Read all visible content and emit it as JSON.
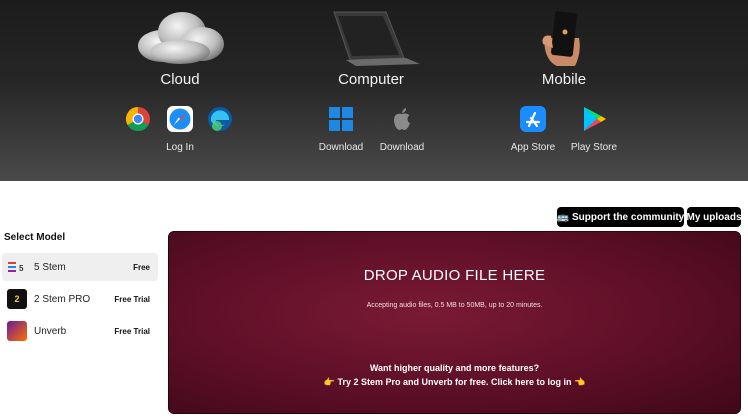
{
  "platforms": {
    "cloud": {
      "title": "Cloud",
      "stores": [
        {
          "icon": "chrome-icon"
        },
        {
          "icon": "safari-icon"
        },
        {
          "icon": "edge-icon"
        }
      ],
      "caption": "Log In"
    },
    "computer": {
      "title": "Computer",
      "stores": [
        {
          "icon": "windows-icon",
          "caption": "Download"
        },
        {
          "icon": "apple-icon",
          "caption": "Download"
        }
      ]
    },
    "mobile": {
      "title": "Mobile",
      "stores": [
        {
          "icon": "app-store-icon",
          "caption": "App Store"
        },
        {
          "icon": "play-store-icon",
          "caption": "Play Store"
        }
      ]
    }
  },
  "toolbar": {
    "support_label": "🚌 Support the community",
    "uploads_label": "My uploads"
  },
  "models": {
    "heading": "Select Model",
    "items": [
      {
        "name": "5 Stem",
        "badge": "5",
        "tag": "Free",
        "selected": true
      },
      {
        "name": "2 Stem PRO",
        "badge": "2",
        "tag": "Free Trial",
        "selected": false
      },
      {
        "name": "Unverb",
        "badge": "",
        "tag": "Free Trial",
        "selected": false
      }
    ]
  },
  "dropzone": {
    "title": "DROP AUDIO FILE HERE",
    "subtitle": "Accepting audio files, 0.5 MB to 50MB, up to 20 minutes.",
    "question": "Want higher quality and more features?",
    "cta": "👉 Try 2 Stem Pro and Unverb for free. Click here to log in 👈"
  },
  "colors": {
    "dropzone_bg": "#5e0f28",
    "hero_bg": "#262626",
    "button_bg": "#000000"
  }
}
